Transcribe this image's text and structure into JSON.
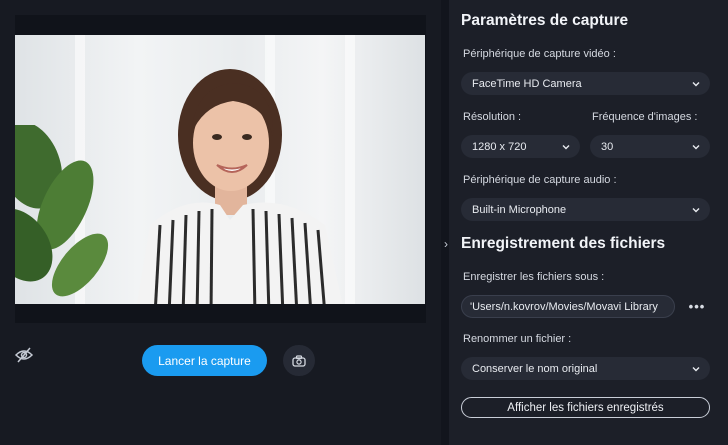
{
  "preview": {
    "capture_button": "Lancer la capture",
    "hide_icon": "eye-slash-icon",
    "snapshot_icon": "camera-icon"
  },
  "settings": {
    "capture_title": "Paramètres de capture",
    "video_device_label": "Périphérique de capture vidéo :",
    "video_device_value": "FaceTime HD Camera",
    "resolution_label": "Résolution :",
    "resolution_value": "1280 x 720",
    "fps_label": "Fréquence d'images :",
    "fps_value": "30",
    "audio_device_label": "Périphérique de capture audio :",
    "audio_device_value": "Built-in Microphone",
    "files_title": "Enregistrement des fichiers",
    "save_as_label": "Enregistrer les fichiers sous :",
    "save_path": "'Users/n.kovrov/Movies/Movavi Library",
    "more_label": "•••",
    "rename_label": "Renommer un fichier :",
    "rename_value": "Conserver le nom original",
    "show_files_button": "Afficher les fichiers enregistrés",
    "collapse_icon": "›"
  },
  "colors": {
    "accent": "#1a9bf0",
    "panel": "#1c1f28",
    "field": "#272b36",
    "background": "#12151d"
  }
}
